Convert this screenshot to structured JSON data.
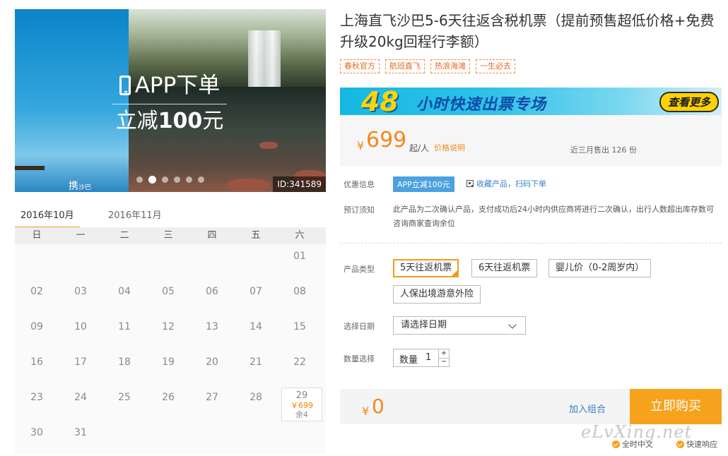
{
  "banner": {
    "headline": "APP下单",
    "discount_prefix": "立减",
    "discount_amount": "100",
    "discount_suffix": "元",
    "logo_text": "携",
    "logo_sub": "沙巴",
    "image_id": "ID:341589",
    "slide_count": 6,
    "active_slide": 1
  },
  "calendar": {
    "months": [
      "2016年10月",
      "2016年11月"
    ],
    "active_month": 0,
    "weekdays": [
      "日",
      "一",
      "二",
      "三",
      "四",
      "五",
      "六"
    ],
    "rows": [
      [
        "",
        "",
        "",
        "",
        "",
        "",
        "01"
      ],
      [
        "02",
        "03",
        "04",
        "05",
        "06",
        "07",
        "08"
      ],
      [
        "09",
        "10",
        "11",
        "12",
        "13",
        "14",
        "15"
      ],
      [
        "16",
        "17",
        "18",
        "19",
        "20",
        "21",
        "22"
      ],
      [
        "23",
        "24",
        "25",
        "26",
        "27",
        "28",
        "29"
      ],
      [
        "30",
        "31",
        "",
        "",
        "",
        "",
        ""
      ]
    ],
    "available_day": {
      "day": "29",
      "price": "￥699",
      "remaining": "余4"
    }
  },
  "product": {
    "title": "上海直飞沙巴5-6天往返含税机票（提前预售超低价格+免费升级20kg回程行李额）",
    "tags": [
      "春秋官方",
      "航班直飞",
      "热浪海滩",
      "一生必去"
    ]
  },
  "promo": {
    "hours": "48",
    "text": "小时快速出票专场",
    "button": "查看更多"
  },
  "price": {
    "currency": "¥",
    "amount": "699",
    "unit": "起/人",
    "note": "价格说明",
    "sold": "近三月售出 126 份"
  },
  "info": {
    "discount_label": "优惠信息",
    "discount_badge": "APP立减100元",
    "qr_text": "收藏产品，扫码下单",
    "notice_label": "预订须知",
    "notice_text": "此产品为二次确认产品，支付成功后24小时内供应商将进行二次确认，出行人数超出库存数可咨询商家查询余位"
  },
  "options": {
    "type_label": "产品类型",
    "types": [
      "5天往返机票",
      "6天往返机票",
      "婴儿价（0-2周岁内）",
      "人保出境游意外险"
    ],
    "selected_type": 0,
    "date_label": "选择日期",
    "date_placeholder": "请选择日期",
    "qty_label": "数量选择",
    "qty_inner_label": "数量",
    "qty_value": "1",
    "qty_plus": "+",
    "qty_minus": "−"
  },
  "buy": {
    "currency": "¥",
    "total": "0",
    "add_combo": "加入组合",
    "buy_now": "立即购买"
  },
  "footer": {
    "watermark": "eLvXing.net",
    "features": [
      "全时中文",
      "快速响应"
    ]
  },
  "colors": {
    "accent": "#f39a1f",
    "price": "#f08a1a",
    "link": "#3a7fc8",
    "badge": "#4aa2e0"
  }
}
